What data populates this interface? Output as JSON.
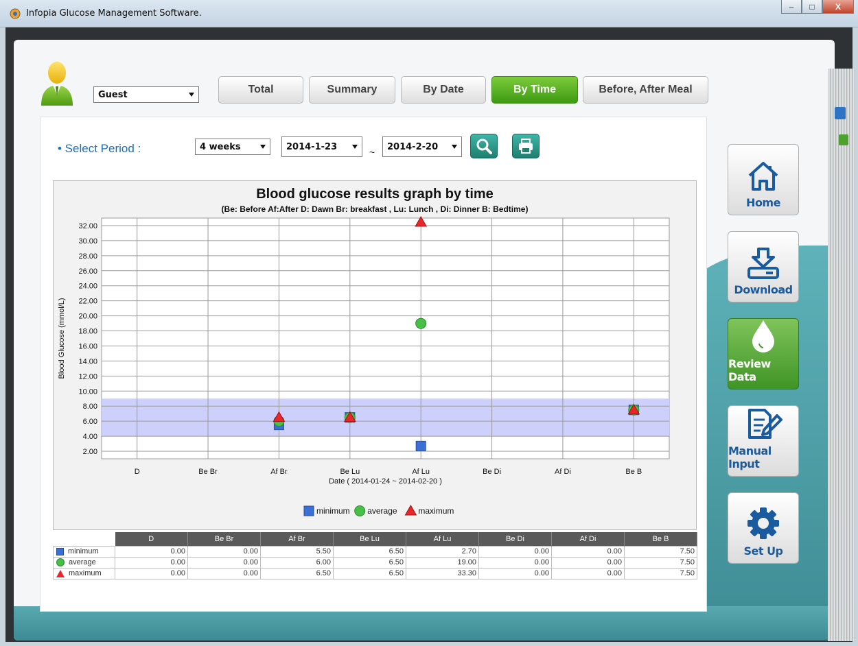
{
  "window": {
    "title": "Infopia Glucose Management Software.",
    "minimize": "–",
    "maximize": "□",
    "close": "X"
  },
  "user": {
    "selected": "Guest"
  },
  "tabs": [
    {
      "label": "Total"
    },
    {
      "label": "Summary"
    },
    {
      "label": "By Date"
    },
    {
      "label": "By Time",
      "active": true
    },
    {
      "label": "Before, After Meal"
    }
  ],
  "period": {
    "label": "• Select Period :",
    "range_option": "4 weeks",
    "start_date": "2014-1-23",
    "separator": "~",
    "end_date": "2014-2-20"
  },
  "nav": [
    {
      "label": "Home",
      "icon": "home-icon"
    },
    {
      "label": "Download",
      "icon": "download-icon"
    },
    {
      "label": "Review Data",
      "icon": "drop-icon",
      "active": true
    },
    {
      "label": "Manual Input",
      "icon": "manual-input-icon"
    },
    {
      "label": "Set Up",
      "icon": "gear-icon"
    }
  ],
  "colors": {
    "minimum": "#3b6fd6",
    "average": "#46c046",
    "maximum": "#e8262c",
    "target_band": "#cdd0fb",
    "active_tab": "#4ea51c"
  },
  "chart_data": {
    "type": "scatter",
    "title": "Blood glucose results graph by time",
    "subtitle": "(Be: Before Af:After D: Dawn Br: breakfast , Lu: Lunch , Di: Dinner B: Bedtime)",
    "ylabel": "Blood Glucose (mmol/L)",
    "xlabel": "Date ( 2014-01-24 ~ 2014-02-20 )",
    "categories": [
      "D",
      "Be Br",
      "Af Br",
      "Be Lu",
      "Af Lu",
      "Be Di",
      "Af Di",
      "Be B"
    ],
    "ylim": [
      1,
      33
    ],
    "yticks": [
      "2.00",
      "4.00",
      "6.00",
      "8.00",
      "10.00",
      "12.00",
      "14.00",
      "16.00",
      "18.00",
      "20.00",
      "22.00",
      "24.00",
      "26.00",
      "28.00",
      "30.00",
      "32.00"
    ],
    "target_range": [
      4.0,
      9.0
    ],
    "grid": true,
    "legend_position": "bottom",
    "series": [
      {
        "name": "minimum",
        "marker": "square",
        "values": [
          0.0,
          0.0,
          5.5,
          6.5,
          2.7,
          0.0,
          0.0,
          7.5
        ]
      },
      {
        "name": "average",
        "marker": "circle",
        "values": [
          0.0,
          0.0,
          6.0,
          6.5,
          19.0,
          0.0,
          0.0,
          7.5
        ]
      },
      {
        "name": "maximum",
        "marker": "triangle",
        "values": [
          0.0,
          0.0,
          6.5,
          6.5,
          33.3,
          0.0,
          0.0,
          7.5
        ]
      }
    ]
  },
  "table": {
    "columns": [
      "D",
      "Be Br",
      "Af Br",
      "Be Lu",
      "Af Lu",
      "Be Di",
      "Af Di",
      "Be B"
    ],
    "rows": [
      {
        "label": "minimum",
        "values": [
          "0.00",
          "0.00",
          "5.50",
          "6.50",
          "2.70",
          "0.00",
          "0.00",
          "7.50"
        ]
      },
      {
        "label": "average",
        "values": [
          "0.00",
          "0.00",
          "6.00",
          "6.50",
          "19.00",
          "0.00",
          "0.00",
          "7.50"
        ]
      },
      {
        "label": "maximum",
        "values": [
          "0.00",
          "0.00",
          "6.50",
          "6.50",
          "33.30",
          "0.00",
          "0.00",
          "7.50"
        ]
      }
    ]
  }
}
